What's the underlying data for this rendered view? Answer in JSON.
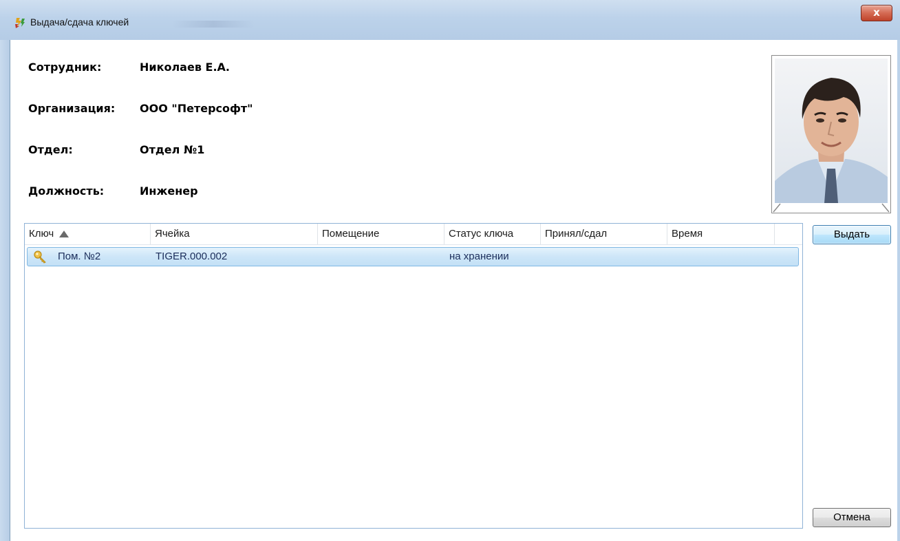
{
  "window": {
    "title": "Выдача/сдача ключей",
    "close_label": "x"
  },
  "employee": {
    "fields": [
      {
        "label": "Сотрудник:",
        "value": "Николаев Е.А."
      },
      {
        "label": "Организация:",
        "value": "ООО \"Петерсофт\""
      },
      {
        "label": "Отдел:",
        "value": "Отдел №1"
      },
      {
        "label": "Должность:",
        "value": "Инженер"
      }
    ]
  },
  "grid": {
    "columns": [
      "Ключ",
      "Ячейка",
      "Помещение",
      "Статус ключа",
      "Принял/сдал",
      "Время"
    ],
    "sort_column": "Ключ",
    "sort_direction": "ascending",
    "rows": [
      {
        "key": "Пом. №2",
        "cell": "TIGER.000.002",
        "room": "",
        "status": "на хранении",
        "accepted_by": "",
        "time": "",
        "icon": "key-icon",
        "selected": true
      }
    ]
  },
  "buttons": {
    "issue_label": "Выдать",
    "cancel_label": "Отмена"
  },
  "colors": {
    "selection": "#cde6f8",
    "grid_border": "#8fb2d6",
    "close_button": "#c0432b"
  }
}
